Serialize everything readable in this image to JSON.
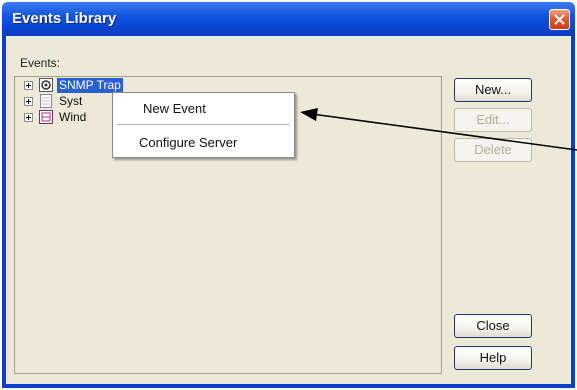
{
  "window": {
    "title": "Events Library"
  },
  "events_panel": {
    "label": "Events:",
    "tree": [
      {
        "label": "SNMP Trap",
        "selected": true
      },
      {
        "label": "Syst",
        "selected": false
      },
      {
        "label": "Wind",
        "selected": false
      }
    ]
  },
  "context_menu": {
    "items": [
      {
        "label": "New Event"
      },
      {
        "label": "Configure Server"
      }
    ]
  },
  "buttons": {
    "new_label": "New...",
    "edit_label": "Edit...",
    "delete_label": "Delete",
    "close_label": "Close",
    "help_label": "Help"
  },
  "colors": {
    "titlebar": "#0a44d0",
    "client_bg": "#ece9d8",
    "selection": "#2a5fd0",
    "close_button": "#e0582c"
  },
  "icons": {
    "close": "close-icon",
    "snmp_trap": "snmp-trap-icon",
    "system": "system-log-icon",
    "windows": "windows-log-icon",
    "annotation": "annotation-arrow"
  }
}
